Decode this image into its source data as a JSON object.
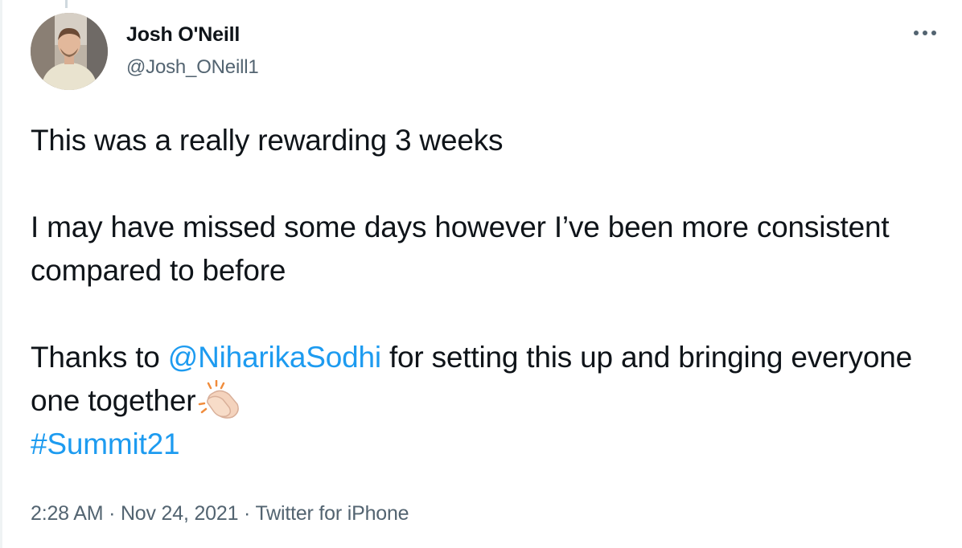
{
  "author": {
    "display_name": "Josh O'Neill",
    "handle": "@Josh_ONeill1",
    "avatar_icon": "profile-photo"
  },
  "more_icon": "more-horizontal-icon",
  "tweet": {
    "line1": "This was a really rewarding 3 weeks",
    "para2": "I may have missed some days however I’ve been more consistent compared to before",
    "para3_prefix": "Thanks to ",
    "mention": "@NiharikaSodhi",
    "para3_suffix": " for setting this up and bringing everyone one together",
    "emoji_icon": "clapping-hands-icon",
    "hashtag": "#Summit21"
  },
  "meta": {
    "time": "2:28 AM",
    "separator": " · ",
    "date": "Nov 24, 2021",
    "source": "Twitter for iPhone"
  },
  "colors": {
    "link": "#1d9bf0",
    "text": "#0f1419",
    "secondary": "#536471"
  }
}
